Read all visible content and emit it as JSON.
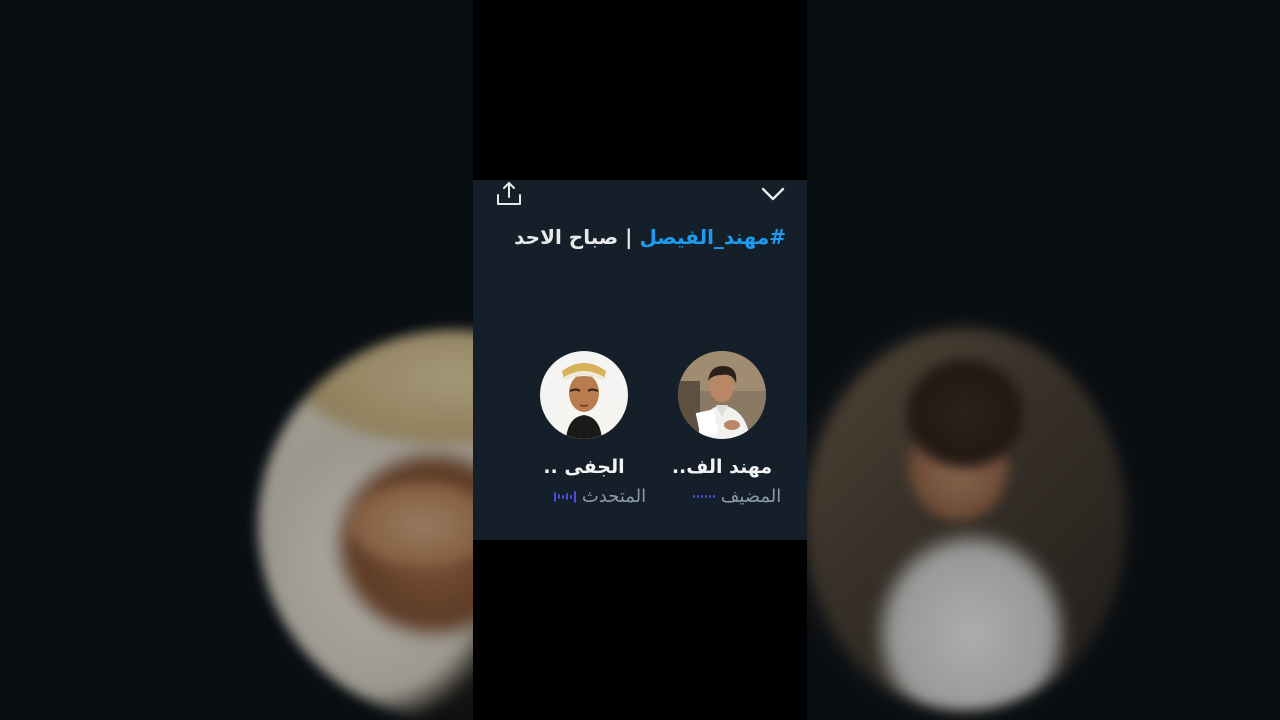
{
  "space": {
    "title_hashtag": "#مهند_الفيصل",
    "title_separator": " | ",
    "title_text": "صباح الاحد"
  },
  "header": {
    "share_icon": "share-upload-icon",
    "collapse_icon": "chevron-down-icon"
  },
  "participants": [
    {
      "name": "مهند الف..",
      "role": "المضيف"
    },
    {
      "name": "الجفى ..",
      "role": "المتحدث"
    }
  ],
  "colors": {
    "card_background": "#151f29",
    "accent_hashtag": "#1d9bf0",
    "speaking_wave": "#4b4fd6",
    "role_text": "#8b98a5"
  }
}
